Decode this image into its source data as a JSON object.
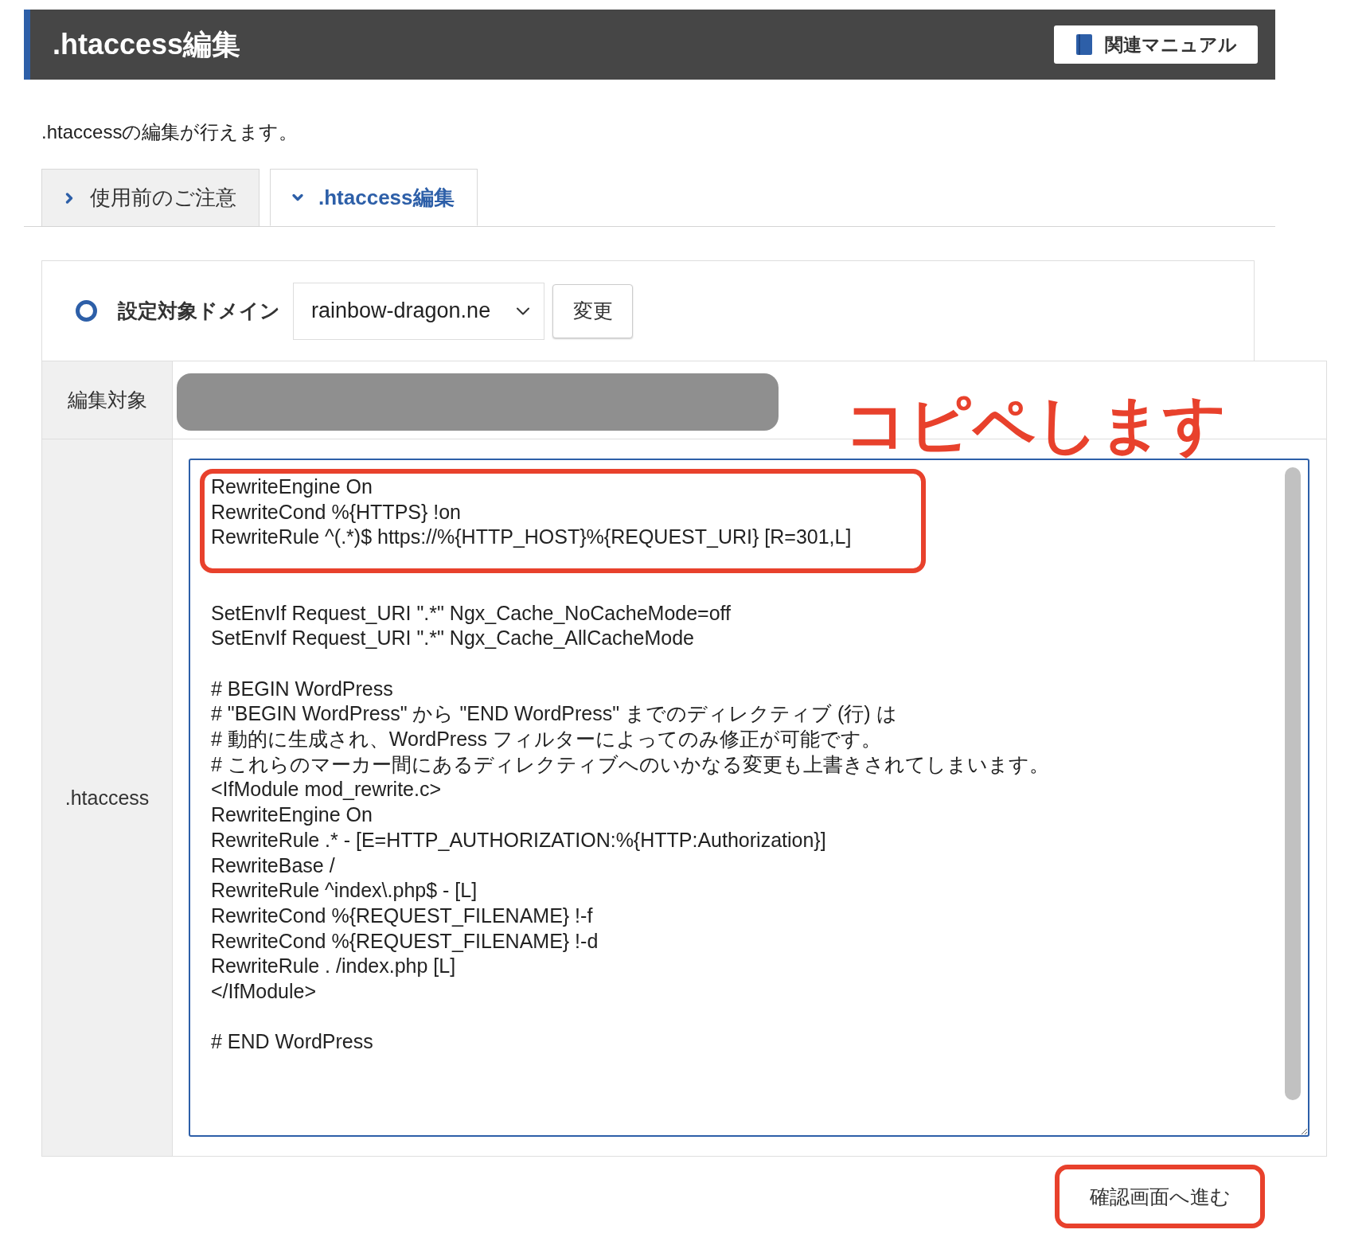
{
  "header": {
    "title": ".htaccess編集",
    "manual_button": "関連マニュアル"
  },
  "description": ".htaccessの編集が行えます。",
  "tabs": [
    {
      "label": "使用前のご注意",
      "selected": false
    },
    {
      "label": ".htaccess編集",
      "selected": true
    }
  ],
  "domain": {
    "label": "設定対象ドメイン",
    "value": "rainbow-dragon.ne",
    "change_button": "変更"
  },
  "table": {
    "edit_target": {
      "label": "編集対象",
      "redacted": true
    },
    "htaccess": {
      "label": ".htaccess",
      "value": "RewriteEngine On\nRewriteCond %{HTTPS} !on\nRewriteRule ^(.*)$ https://%{HTTP_HOST}%{REQUEST_URI} [R=301,L]\n\n\nSetEnvIf Request_URI \".*\" Ngx_Cache_NoCacheMode=off\nSetEnvIf Request_URI \".*\" Ngx_Cache_AllCacheMode\n\n# BEGIN WordPress\n# \"BEGIN WordPress\" から \"END WordPress\" までのディレクティブ (行) は\n# 動的に生成され、WordPress フィルターによってのみ修正が可能です。\n# これらのマーカー間にあるディレクティブへのいかなる変更も上書きされてしまいます。\n<IfModule mod_rewrite.c>\nRewriteEngine On\nRewriteRule .* - [E=HTTP_AUTHORIZATION:%{HTTP:Authorization}]\nRewriteBase /\nRewriteRule ^index\\.php$ - [L]\nRewriteCond %{REQUEST_FILENAME} !-f\nRewriteCond %{REQUEST_FILENAME} !-d\nRewriteRule . /index.php [L]\n</IfModule>\n\n# END WordPress",
      "highlighted": true
    }
  },
  "annotation": {
    "note": "コピペします"
  },
  "confirm_button": {
    "label": "確認画面へ進む",
    "highlighted": true
  }
}
